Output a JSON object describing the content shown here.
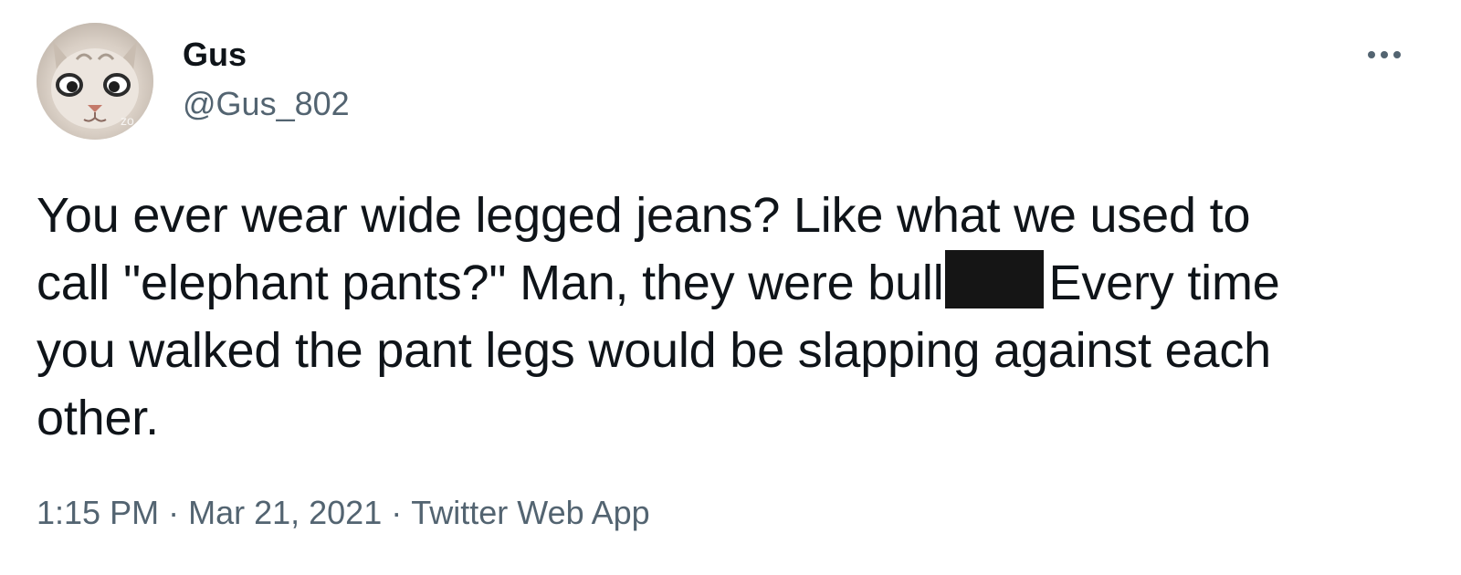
{
  "author": {
    "name": "Gus",
    "handle": "@Gus_802",
    "avatar_icon": "cat-face-avatar"
  },
  "menu": {
    "icon": "more-horizontal-icon"
  },
  "tweet": {
    "lines": [
      "You ever wear wide legged jeans? Like what we used to",
      "call \"elephant pants?\" Man, they were bull",
      "Every time",
      "you walked the pant legs would be slapping against each",
      "other."
    ]
  },
  "meta": {
    "time": "1:15 PM",
    "separator": "·",
    "date": "Mar 21, 2021",
    "source": "Twitter Web App"
  },
  "colors": {
    "text": "#0f1419",
    "secondary": "#536471",
    "redaction": "#151515",
    "background": "#ffffff"
  }
}
